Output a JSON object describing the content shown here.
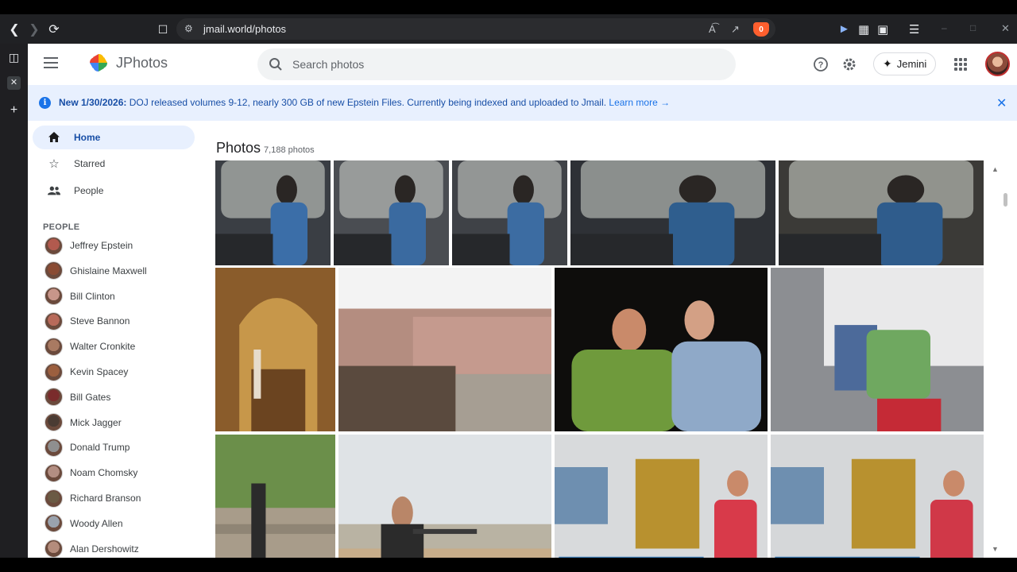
{
  "browser": {
    "url": "jmail.world/photos",
    "brave_badge": "0"
  },
  "app": {
    "name": "JPhotos",
    "search_placeholder": "Search photos",
    "assistant_label": "Jemini"
  },
  "banner": {
    "prefix": "New 1/30/2026:",
    "message": "DOJ released volumes 9-12, nearly 300 GB of new Epstein Files. Currently being indexed and uploaded to Jmail.",
    "link": "Learn more →"
  },
  "nav": {
    "items": [
      {
        "label": "Home",
        "icon": "home-icon",
        "active": true
      },
      {
        "label": "Starred",
        "icon": "star-icon",
        "active": false
      },
      {
        "label": "People",
        "icon": "people-icon",
        "active": false
      }
    ]
  },
  "people": {
    "header": "PEOPLE",
    "list": [
      {
        "name": "Jeffrey Epstein",
        "color": "#b25a4e"
      },
      {
        "name": "Ghislaine Maxwell",
        "color": "#8a4b33"
      },
      {
        "name": "Bill Clinton",
        "color": "#c8968a"
      },
      {
        "name": "Steve Bannon",
        "color": "#b86a5a"
      },
      {
        "name": "Walter Cronkite",
        "color": "#a97a62"
      },
      {
        "name": "Kevin Spacey",
        "color": "#9c5f3f"
      },
      {
        "name": "Bill Gates",
        "color": "#7a2c2c"
      },
      {
        "name": "Mick Jagger",
        "color": "#4a3b33"
      },
      {
        "name": "Donald Trump",
        "color": "#8f8f8f"
      },
      {
        "name": "Noam Chomsky",
        "color": "#b38e82"
      },
      {
        "name": "Richard Branson",
        "color": "#6a5a44"
      },
      {
        "name": "Woody Allen",
        "color": "#9aa2ad"
      },
      {
        "name": "Alan Dershowitz",
        "color": "#b48c7c"
      }
    ]
  },
  "photos": {
    "title": "Photos",
    "count": "7,188 photos",
    "items": [
      {
        "subject": "helicopter-cockpit",
        "bg": "#3a3e44",
        "accent": "#3b6ea8"
      },
      {
        "subject": "helicopter-cockpit",
        "bg": "#4a4d52",
        "accent": "#3a6aa0"
      },
      {
        "subject": "helicopter-cockpit",
        "bg": "#3f4247",
        "accent": "#3c6ca2"
      },
      {
        "subject": "helicopter-cockpit",
        "bg": "#2e3136",
        "accent": "#2f5e8e"
      },
      {
        "subject": "helicopter-cockpit",
        "bg": "#3b3a37",
        "accent": "#2f5c8c"
      },
      {
        "subject": "arched-hallway",
        "bg": "#8a5c2b",
        "accent": "#c7974a"
      },
      {
        "subject": "courtyard",
        "bg": "#b48d80",
        "accent": "#5a4a3e"
      },
      {
        "subject": "two-men-talking",
        "bg": "#0e0d0c",
        "accent": "#6f9a3c"
      },
      {
        "subject": "helicopter-cabin",
        "bg": "#8c8e92",
        "accent": "#6fa860"
      },
      {
        "subject": "ranch-fence",
        "bg": "#6b8f4a",
        "accent": "#a89c8a"
      },
      {
        "subject": "shooting-range",
        "bg": "#b9b3a3",
        "accent": "#2b2b2b"
      },
      {
        "subject": "table-tennis",
        "bg": "#d8dadc",
        "accent": "#d83a4a"
      },
      {
        "subject": "table-tennis",
        "bg": "#d5d7d9",
        "accent": "#d03848"
      }
    ]
  }
}
